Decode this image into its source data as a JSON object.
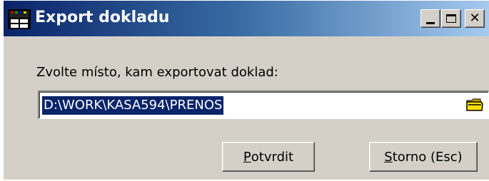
{
  "window": {
    "title": "Export dokladu",
    "icons": {
      "app": "app-icon",
      "minimize": "minimize-icon",
      "maximize": "maximize-icon",
      "close": "close-icon"
    }
  },
  "form": {
    "prompt": "Zvolte místo, kam exportovat doklad:",
    "path_value": "D:\\WORK\\KASA594\\PRENOS",
    "browse_icon": "folder-icon"
  },
  "buttons": {
    "confirm": {
      "mnemonic": "P",
      "rest": "otvrdit"
    },
    "cancel": {
      "mnemonic": "S",
      "rest": "torno (Esc)"
    }
  },
  "colors": {
    "titlebar_start": "#0a246a",
    "titlebar_end": "#a6caf0",
    "face": "#d4d0c8",
    "selection": "#0a246a"
  }
}
